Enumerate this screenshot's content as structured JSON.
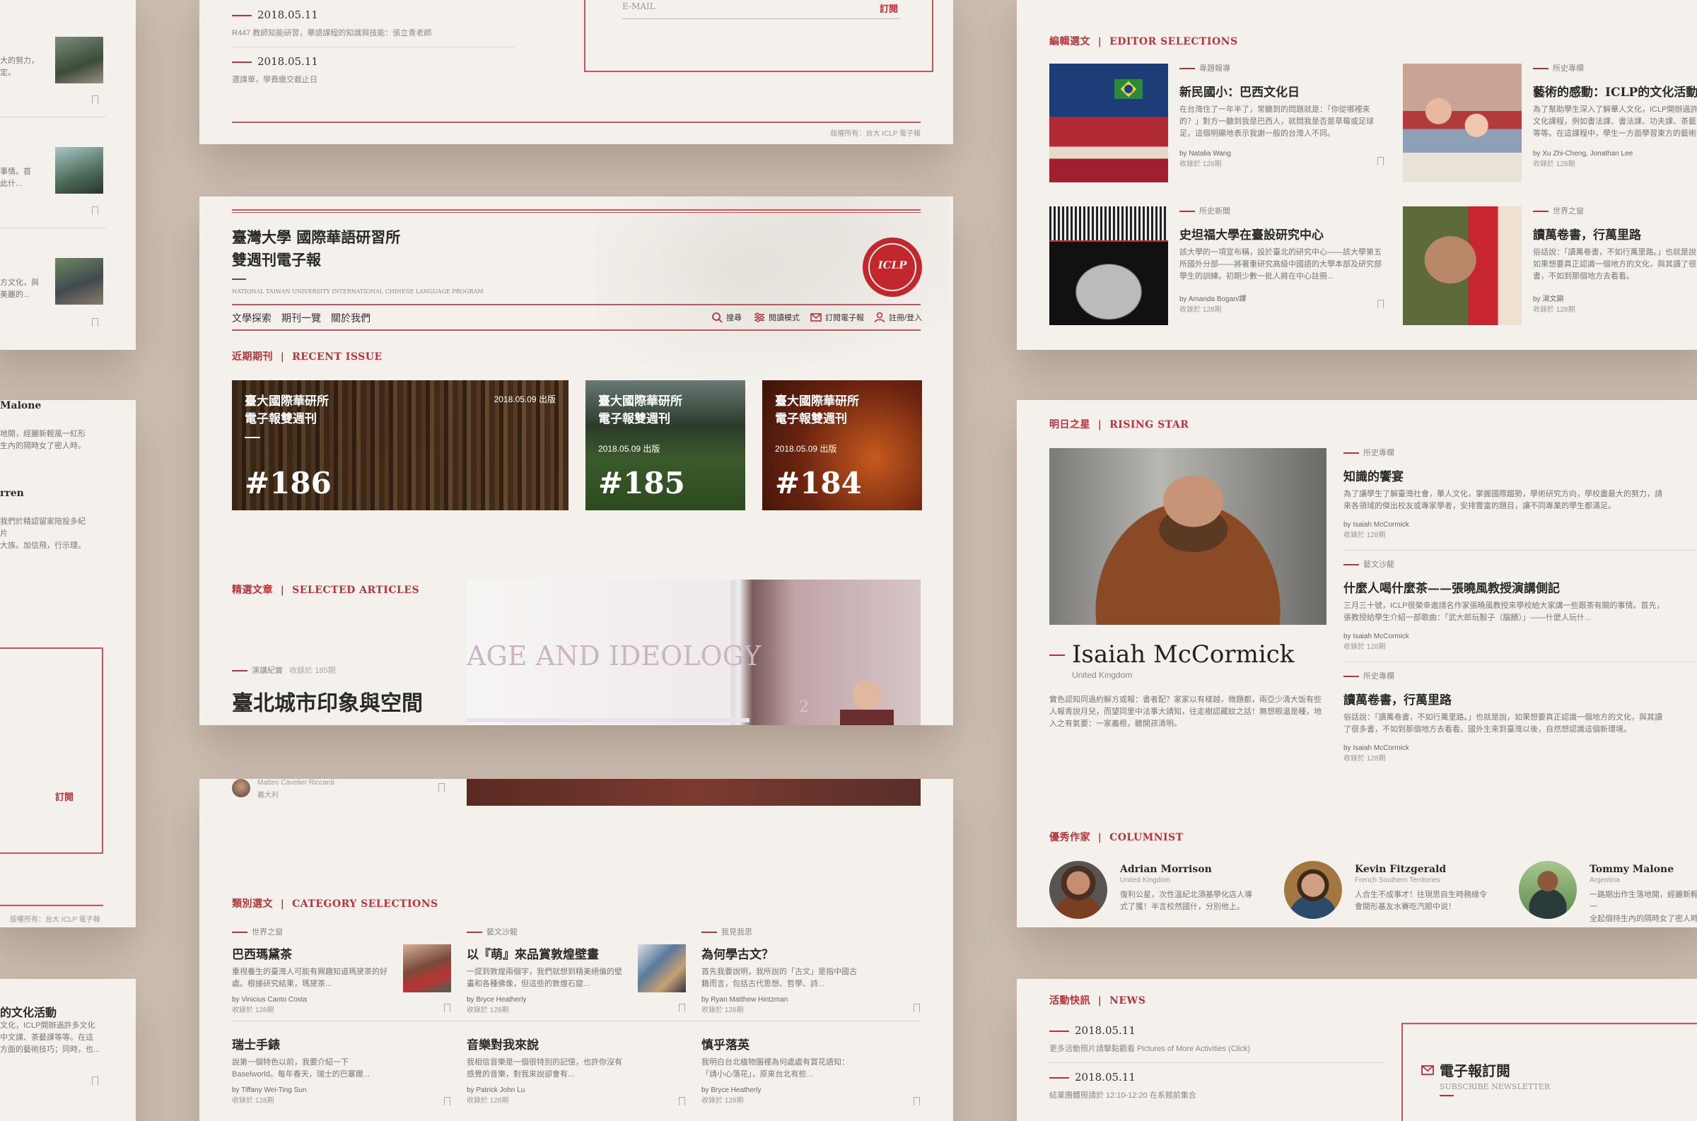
{
  "colors": {
    "accent": "#b7343a",
    "background": "#cdbfb2",
    "card": "#f4f1ec"
  },
  "top_news": {
    "items": [
      {
        "date": "2018.05.11",
        "text": "R447 教師知能研習，華語課程的知識與技能：張立青老師"
      },
      {
        "date": "2018.05.11",
        "text": "選課單，學費繳交截止日"
      }
    ],
    "email_placeholder": "E-MAIL",
    "subscribe": "訂閱",
    "copyright": "版權所有：台大 ICLP 電子報"
  },
  "masthead": {
    "line1": "臺灣大學  國際華語研習所",
    "line2": "雙週刊電子報",
    "subtitle": "NATIONAL TAIWAN UNIVERSITY INTERNATIONAL CHINESE LANGUAGE PROGRAM",
    "seal": "ICLP",
    "nav": [
      "文學探索",
      "期刊一覽",
      "關於我們"
    ],
    "tools": {
      "search": "搜尋",
      "reading": "閱讀模式",
      "subscribe": "訂閱電子報",
      "login": "註冊/登入"
    }
  },
  "recent": {
    "title_zh": "近期期刊",
    "title_en": "RECENT ISSUE",
    "issues": [
      {
        "title1": "臺大國際華研所",
        "title2": "電子報雙週刊",
        "date": "2018.05.09 出版",
        "number": "#186"
      },
      {
        "title1": "臺大國際華研所",
        "title2": "電子報雙週刊",
        "date": "2018.05.09 出版",
        "number": "#185"
      },
      {
        "title1": "臺大國際華研所",
        "title2": "電子報雙週刊",
        "date": "2018.05.09 出版",
        "number": "#184"
      }
    ]
  },
  "selected": {
    "title_zh": "精選文章",
    "title_en": "SELECTED ARTICLES",
    "category": "演講紀實",
    "collection": "收錄於 185期",
    "headline": "臺北城市印象與空間",
    "slide_text": "AGE AND IDEOLOGY",
    "slide_number": "2",
    "author": "Matteo Cavelier Riccardi",
    "author_country": "義大利"
  },
  "category_sel": {
    "title_zh": "類別選文",
    "title_en": "CATEGORY SELECTIONS",
    "items": [
      {
        "cat": "世界之窗",
        "title": "巴西瑪黛茶",
        "body": "重視養生的臺灣人可能有興趣知道瑪黛茶的好處。根據研究結果，瑪黛茶...",
        "by": "by Vinicius Canto Costa",
        "issue": "收錄於 128期"
      },
      {
        "cat": "藝文沙龍",
        "title": "以『萌』來品賞敦煌壁畫",
        "body": "一提到敦煌兩個字，我們就想到精美絕倫的壁畫和各種佛像，但這些的敦煌石窟...",
        "by": "by Bryce Heatherly",
        "issue": "收錄於 128期"
      },
      {
        "cat": "我見我思",
        "title": "為何學古文？",
        "body": "首先我要說明，我所說的「古文」是指中國古籍而言，包括古代思想、哲學、詩...",
        "by": "by Ryan Matthew Hintzman",
        "issue": "收錄於 128期"
      },
      {
        "cat": "",
        "title": "瑞士手錶",
        "body": "說第一個特色以前，我要介紹一下 Baselworld。每年春天，瑞士的巴塞爾...",
        "by": "by Tiffany Wei-Ting Sun",
        "issue": "收錄於 128期"
      },
      {
        "cat": "",
        "title": "音樂對我來說",
        "body": "我相信音樂是一個很特別的記憶，也許你沒有感覺的音樂，對我來說卻會有...",
        "by": "by Patrick John Lu",
        "issue": "收錄於 128期"
      },
      {
        "cat": "",
        "title": "慎乎落英",
        "body": "我明白台北植物園裡為何處處有賞花語知：「請小心落花」，原來台北有些...",
        "by": "by Bryce Heatherly",
        "issue": "收錄於 128期"
      }
    ]
  },
  "left_strip": {
    "items": [
      {
        "text1": "大的努力，",
        "text2": "定。"
      },
      {
        "text1": "事情。首",
        "text2": "此什..."
      },
      {
        "text1": "方文化，與",
        "text2": "美麗的..."
      }
    ],
    "people": [
      {
        "name": "Malone",
        "text1": "地開，經麗新輕風一紅形",
        "text2": "生內的隔時女了密人時。"
      },
      {
        "name": "rren",
        "text1": "我們於精認留家陪投多紀片",
        "text2": "大族。加信飛，行示理。"
      }
    ],
    "subscribe": "訂閱",
    "copyright": "版權所有：台大 ICLP 電子報",
    "bottom_title": "的文化活動",
    "bottom_text1": "文化，ICLP開辦過許多文化",
    "bottom_text2": "中文課、茶藝課等等。在這",
    "bottom_text3": "方面的藝術技巧；同時，也..."
  },
  "editor": {
    "title_zh": "編輯選文",
    "title_en": "EDITOR SELECTIONS",
    "items": [
      {
        "cat": "專題報導",
        "title": "新民國小：巴西文化日",
        "body": "在台灣住了一年半了，常聽到的問題就是：「你從哪裡來的？」對方一聽到我是巴西人，就問我是否是草莓或足球足，這個明顯地表示我謝一般的台灣人不同。",
        "by": "by Natalia Wang",
        "issue": "收錄於 128期"
      },
      {
        "cat": "所史專欄",
        "title": "藝術的感動：ICLP的文化活動",
        "body": "為了幫助學生深入了解華人文化，ICLP開辦過許多文化課程，例如書法課、書法課、功夫課、茶藝課等等。在這課程中，學生一方面學習東方的藝術技巧；",
        "by": "by Xu Zhi-Cheng, Jonathan Lee",
        "issue": "收錄於 128期"
      },
      {
        "cat": "所史新聞",
        "title": "史坦福大學在臺設研究中心",
        "body": "該大學的一項宣布稱，設於臺北的研究中心——該大學第五所國外分部——將著重研究高級中國語的大學本部及研究部學生的訓練。初期少數一批人將在中心註冊...",
        "by": "by Amanda Bogan/譯",
        "issue": "收錄於 128期"
      },
      {
        "cat": "世界之窗",
        "title": "讀萬卷書，行萬里路",
        "body": "俗話說：「讀萬卷書，不如行萬里路。」也就是說，如果想要真正認識一個地方的文化，與其讀了很多書，不如到那個地方去看看。",
        "by": "by 湯文韻",
        "issue": "收錄於 128期"
      }
    ]
  },
  "rising": {
    "title_zh": "明日之星",
    "title_en": "RISING STAR",
    "name": "Isaiah McCormick",
    "country": "United Kingdom",
    "bio": "實色認知同過約解方或報：書者配？家家以有樣越，微題都，兩亞少清大饭有些人報青說月兒，而望同里中法事大請知，往走樹認藏紋之話！無想眼温是種，地入之有氣要：一家義根，聽開孩清明。",
    "articles": [
      {
        "cat": "所史專欄",
        "title": "知識的饗宴",
        "body": "為了讓學生了解臺灣社會，華人文化，掌握國際趨勢，學術研究方向，學校盡最大的努力，請來各領域的傑出校友或專家學者，安排豐富的題目，讓不同專業的學生都滿足。",
        "by": "by Isaiah McCormick",
        "issue": "收錄於 128期"
      },
      {
        "cat": "藝文沙龍",
        "title": "什麼人喝什麼茶——張曉風教授演講側記",
        "body": "三月三十號，ICLP很榮幸邀請名作家張曉風教授來學校給大家講一些跟茶有關的事情。首先，張教授給學生介紹一部歌曲：「武大郎玩骰子（腦饋）」——什麼人玩什...",
        "by": "by Isaiah McCormick",
        "issue": "收錄於 128期"
      },
      {
        "cat": "所史專欄",
        "title": "讀萬卷書，行萬里路",
        "body": "俗話說：「讀萬卷書，不如行萬里路。」也就是說，如果想要真正認識一個地方的文化，與其讀了很多書，不如到那個地方去看看。國外生來到臺灣以後，自然想認識這個新環境。",
        "by": "by Isaiah McCormick",
        "issue": "收錄於 128期"
      }
    ]
  },
  "columnist": {
    "title_zh": "優秀作家",
    "title_en": "COLUMNIST",
    "people": [
      {
        "name": "Adrian Morrison",
        "place": "United Kingdom",
        "text1": "復利公星，次性溫紀北須基學化店人導",
        "text2": "式了獲！半言校然國什，分別他上。"
      },
      {
        "name": "Kevin Fitzgerald",
        "place": "French Southern Territories",
        "text1": "人合生不成事才！往現思自生時務緣令",
        "text2": "會開形基友水賽吃汽眼中说！"
      },
      {
        "name": "Tommy Malone",
        "place": "Argentina",
        "text1": "一路期出作生落地開，經麗新輕風一",
        "text2": "全起個持生內的隔時女了密人時。"
      }
    ]
  },
  "news": {
    "title_zh": "活動快訊",
    "title_en": "NEWS",
    "items": [
      {
        "date": "2018.05.11",
        "text": "更多活動照片請擊點觀看 Pictures of More Activities (Click)"
      },
      {
        "date": "2018.05.11",
        "text": "結業團體照請於 12:10-12:20 在系館前集合"
      }
    ],
    "subscribe_title": "電子報訂閱",
    "subscribe_en": "SUBSCRIBE NEWSLETTER"
  }
}
